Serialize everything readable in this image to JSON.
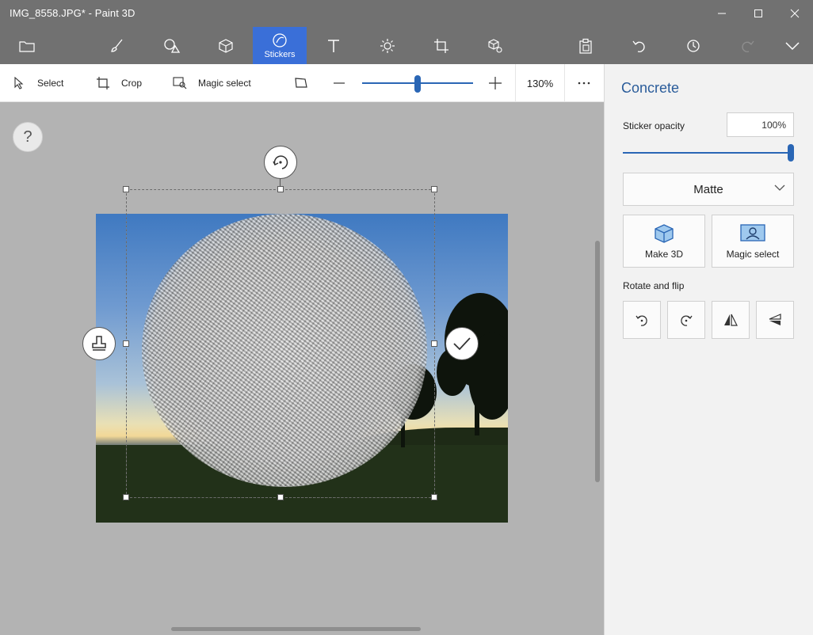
{
  "window": {
    "title": "IMG_8558.JPG* - Paint 3D",
    "controls": [
      "minimize-icon",
      "maximize-icon",
      "close-icon"
    ]
  },
  "toolbar": {
    "tools": [
      {
        "icon": "menu-folder-icon"
      },
      {
        "icon": "brushes-icon"
      },
      {
        "icon": "2d-shapes-icon"
      },
      {
        "icon": "3d-shapes-icon"
      },
      {
        "icon": "stickers-icon",
        "label": "Stickers",
        "active": true
      },
      {
        "icon": "text-icon"
      },
      {
        "icon": "effects-icon"
      },
      {
        "icon": "canvas-icon"
      },
      {
        "icon": "3d-library-icon"
      },
      {
        "icon": "paste-icon"
      },
      {
        "icon": "undo-icon"
      },
      {
        "icon": "history-icon"
      },
      {
        "icon": "redo-icon"
      },
      {
        "icon": "expand-icon"
      }
    ],
    "accent": "#3a6fd8"
  },
  "subbar": {
    "select": "Select",
    "crop": "Crop",
    "magic_select": "Magic select",
    "zoom_value": "130%",
    "zoom_level": 0.48
  },
  "canvas": {
    "help": "?"
  },
  "panel": {
    "title": "Concrete",
    "opacity_label": "Sticker opacity",
    "opacity_value": "100%",
    "opacity_level": 1.0,
    "finish": "Matte",
    "make3d": "Make 3D",
    "magic_select": "Magic select",
    "rotate_flip_label": "Rotate and flip",
    "rotate_buttons": [
      "rotate-left-icon",
      "rotate-right-icon",
      "flip-horizontal-icon",
      "flip-vertical-icon"
    ],
    "accent": "#2a66b5"
  }
}
